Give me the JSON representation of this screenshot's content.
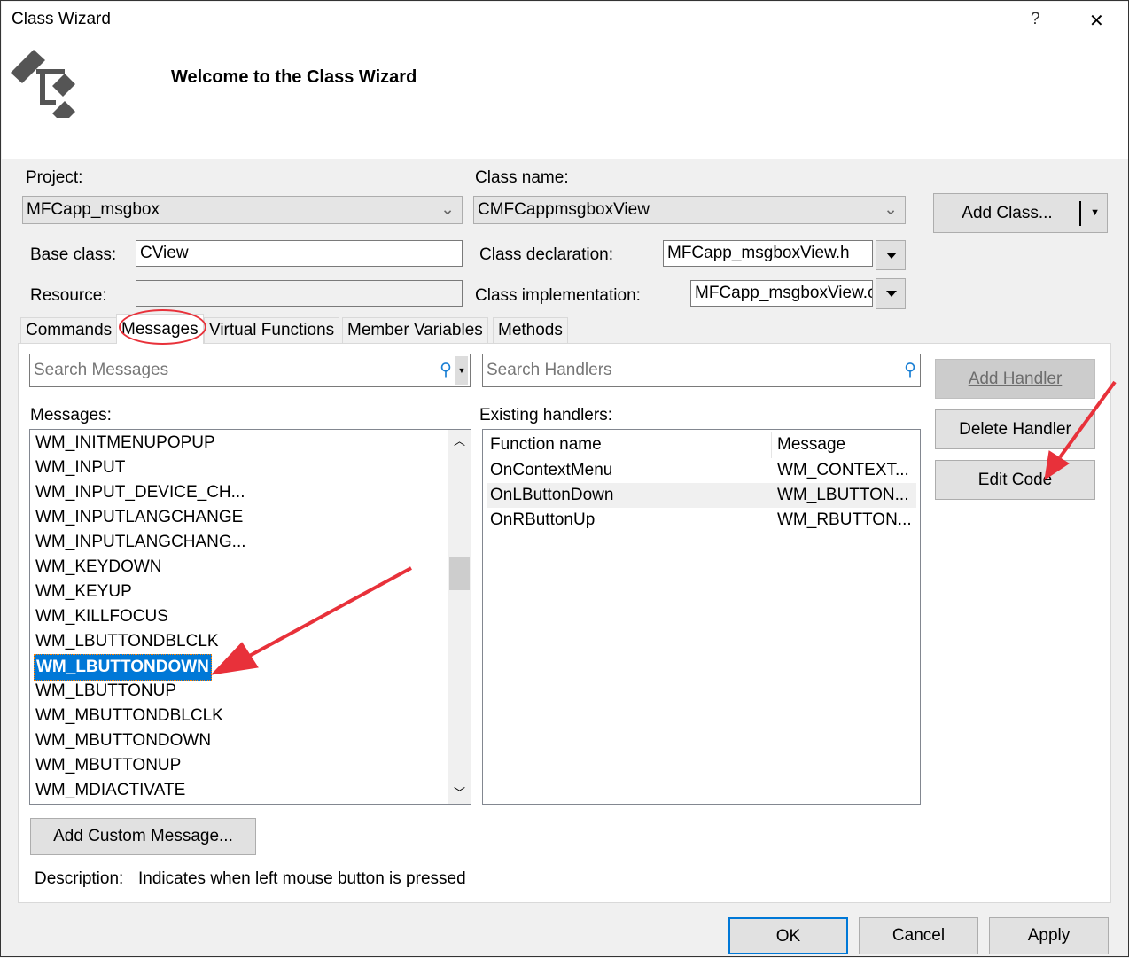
{
  "window": {
    "title": "Class Wizard",
    "help": "?",
    "close": "✕"
  },
  "header": {
    "title": "Welcome to the Class Wizard",
    "icon": "class-hierarchy-icon"
  },
  "project": {
    "label": "Project:",
    "value": "MFCapp_msgbox"
  },
  "class_name": {
    "label": "Class name:",
    "value": "CMFCappmsgboxView"
  },
  "add_class": "Add Class...",
  "base_class": {
    "label": "Base class:",
    "value": "CView"
  },
  "resource": {
    "label": "Resource:",
    "value": ""
  },
  "class_declaration": {
    "label": "Class declaration:",
    "value": "MFCapp_msgboxView.h"
  },
  "class_implementation": {
    "label": "Class implementation:",
    "value": "MFCapp_msgboxView.cpp"
  },
  "tabs": [
    "Commands",
    "Messages",
    "Virtual Functions",
    "Member Variables",
    "Methods"
  ],
  "active_tab": "Messages",
  "search_messages": {
    "placeholder": "Search Messages"
  },
  "search_handlers": {
    "placeholder": "Search Handlers"
  },
  "messages_label": "Messages:",
  "messages": [
    "WM_INITMENUPOPUP",
    "WM_INPUT",
    "WM_INPUT_DEVICE_CH...",
    "WM_INPUTLANGCHANGE",
    "WM_INPUTLANGCHANG...",
    "WM_KEYDOWN",
    "WM_KEYUP",
    "WM_KILLFOCUS",
    "WM_LBUTTONDBLCLK",
    "WM_LBUTTONDOWN",
    "WM_LBUTTONUP",
    "WM_MBUTTONDBLCLK",
    "WM_MBUTTONDOWN",
    "WM_MBUTTONUP",
    "WM_MDIACTIVATE"
  ],
  "selected_message": "WM_LBUTTONDOWN",
  "handlers_label": "Existing handlers:",
  "handler_columns": [
    "Function name",
    "Message"
  ],
  "handlers": [
    [
      "OnContextMenu",
      "WM_CONTEXT..."
    ],
    [
      "OnLButtonDown",
      "WM_LBUTTON..."
    ],
    [
      "OnRButtonUp",
      "WM_RBUTTON..."
    ]
  ],
  "buttons": {
    "add_handler": "Add Handler",
    "delete_handler": "Delete Handler",
    "edit_code": "Edit Code",
    "add_custom_message": "Add Custom Message...",
    "ok": "OK",
    "cancel": "Cancel",
    "apply": "Apply"
  },
  "description": {
    "label": "Description:",
    "value": "Indicates when left mouse button is pressed"
  },
  "colors": {
    "selection": "#0078d7",
    "annotation": "#e8313a"
  }
}
